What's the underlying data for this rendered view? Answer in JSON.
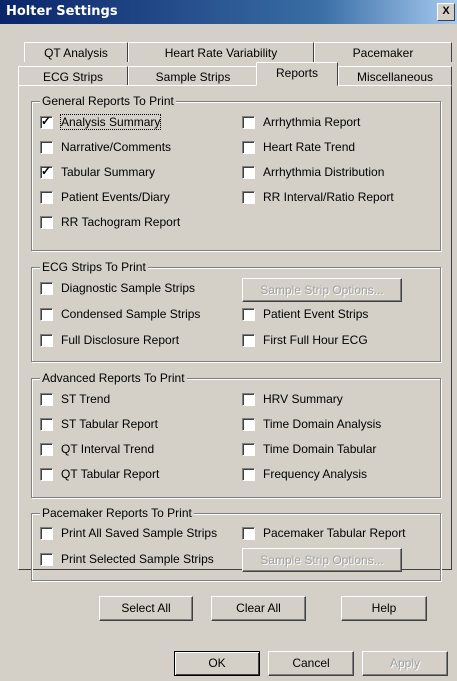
{
  "window": {
    "title": "Holter Settings",
    "close_label": "X"
  },
  "tabs_back": [
    "QT Analysis",
    "Heart Rate Variability",
    "Pacemaker"
  ],
  "tabs_front": [
    "ECG Strips",
    "Sample Strips",
    "Reports",
    "Miscellaneous"
  ],
  "general": {
    "title": "General Reports To Print",
    "left": [
      {
        "label": "Analysis Summary",
        "checked": true
      },
      {
        "label": "Narrative/Comments",
        "checked": false
      },
      {
        "label": "Tabular Summary",
        "checked": true
      },
      {
        "label": "Patient Events/Diary",
        "checked": false
      },
      {
        "label": "RR Tachogram Report",
        "checked": false
      }
    ],
    "right": [
      {
        "label": "Arrhythmia Report",
        "checked": false
      },
      {
        "label": "Heart Rate Trend",
        "checked": false
      },
      {
        "label": "Arrhythmia Distribution",
        "checked": false
      },
      {
        "label": "RR Interval/Ratio Report",
        "checked": false
      }
    ]
  },
  "ecg": {
    "title": "ECG Strips To Print",
    "left": [
      {
        "label": "Diagnostic Sample Strips",
        "checked": false
      },
      {
        "label": "Condensed Sample Strips",
        "checked": false
      },
      {
        "label": "Full Disclosure Report",
        "checked": false
      }
    ],
    "button": "Sample Strip Options...",
    "right": [
      {
        "label": "Patient Event Strips",
        "checked": false
      },
      {
        "label": "First Full Hour ECG",
        "checked": false
      }
    ]
  },
  "advanced": {
    "title": "Advanced Reports To Print",
    "left": [
      {
        "label": "ST Trend",
        "checked": false
      },
      {
        "label": "ST Tabular Report",
        "checked": false
      },
      {
        "label": "QT Interval Trend",
        "checked": false
      },
      {
        "label": "QT Tabular Report",
        "checked": false
      }
    ],
    "right": [
      {
        "label": "HRV Summary",
        "checked": false
      },
      {
        "label": "Time Domain Analysis",
        "checked": false
      },
      {
        "label": "Time Domain Tabular",
        "checked": false
      },
      {
        "label": "Frequency Analysis",
        "checked": false
      }
    ]
  },
  "pacemaker": {
    "title": "Pacemaker Reports To Print",
    "left": [
      {
        "label": "Print All Saved Sample Strips",
        "checked": false
      },
      {
        "label": "Print Selected Sample Strips",
        "checked": false
      }
    ],
    "right": [
      {
        "label": "Pacemaker Tabular Report",
        "checked": false
      }
    ],
    "button": "Sample Strip Options..."
  },
  "actions": {
    "select_all": "Select All",
    "clear_all": "Clear All",
    "help": "Help"
  },
  "footer": {
    "ok": "OK",
    "cancel": "Cancel",
    "apply": "Apply"
  }
}
